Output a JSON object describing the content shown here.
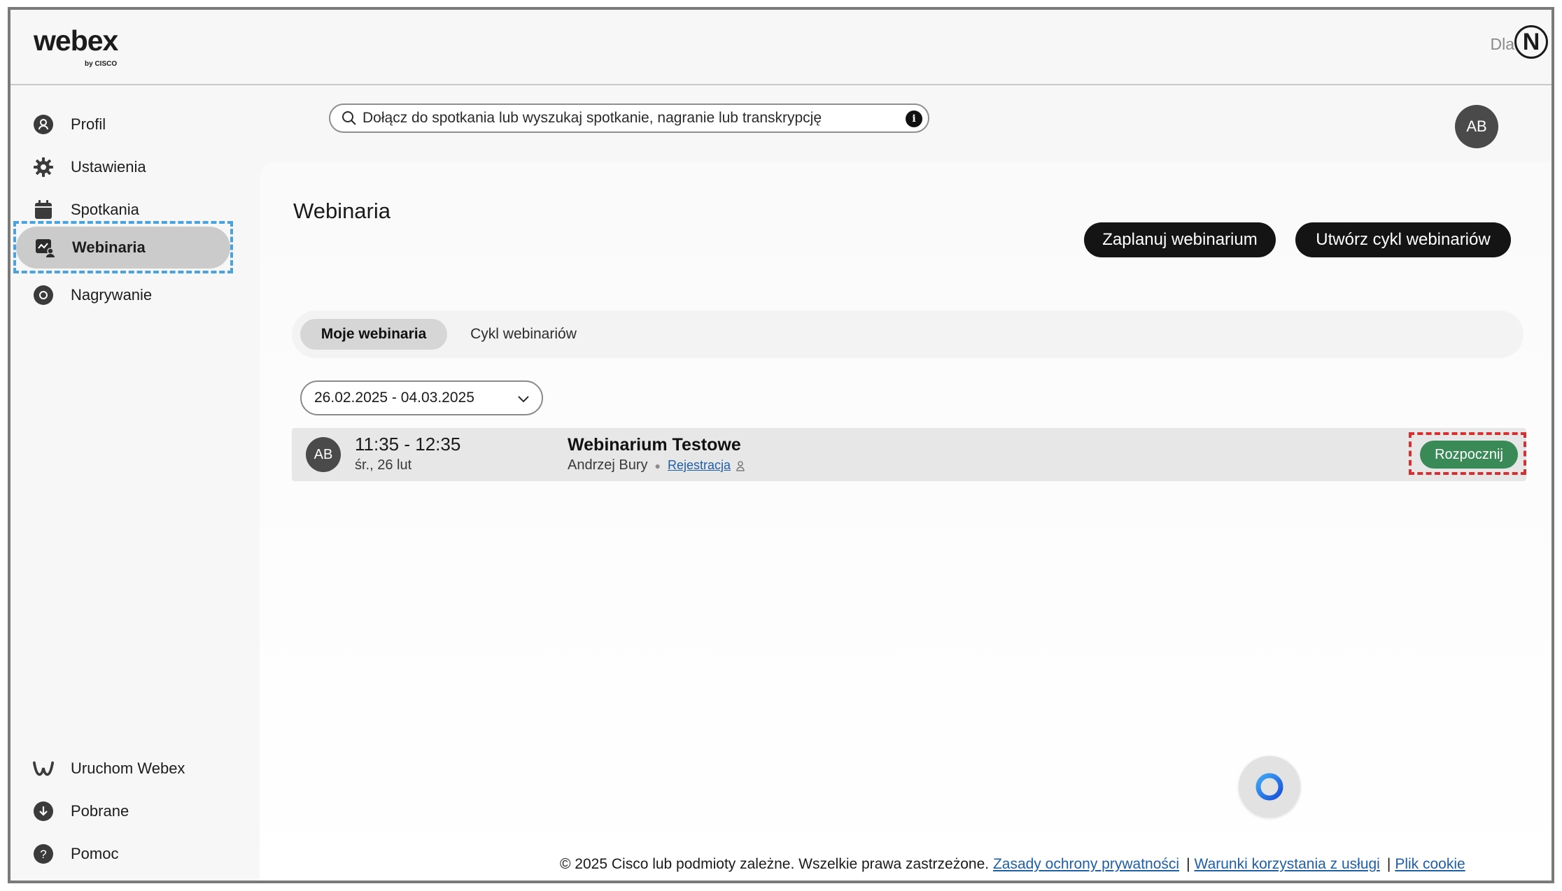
{
  "header": {
    "logo_text": "webex",
    "logo_sub": "by CISCO",
    "right_text": "Dla",
    "brand_letter": "N"
  },
  "sidebar": {
    "items": [
      {
        "label": "Profil",
        "icon": "profile-icon"
      },
      {
        "label": "Ustawienia",
        "icon": "gear-icon"
      },
      {
        "label": "Spotkania",
        "icon": "calendar-icon"
      },
      {
        "label": "Webinaria",
        "icon": "webinar-icon",
        "active": true
      },
      {
        "label": "Nagrywanie",
        "icon": "record-icon"
      }
    ],
    "bottom_items": [
      {
        "label": "Uruchom Webex",
        "icon": "webex-logo-icon"
      },
      {
        "label": "Pobrane",
        "icon": "download-icon"
      },
      {
        "label": "Pomoc",
        "icon": "help-icon"
      }
    ]
  },
  "search": {
    "placeholder": "Dołącz do spotkania lub wyszukaj spotkanie, nagranie lub transkrypcję"
  },
  "user": {
    "initials": "AB"
  },
  "main": {
    "title": "Webinaria",
    "schedule_button": "Zaplanuj webinarium",
    "create_series_button": "Utwórz cykl webinariów",
    "tabs": [
      {
        "label": "Moje webinaria",
        "selected": true
      },
      {
        "label": "Cykl webinariów",
        "selected": false
      }
    ],
    "date_range": "26.02.2025 - 04.03.2025",
    "webinars": [
      {
        "host_initials": "AB",
        "time": "11:35 - 12:35",
        "date": "śr., 26 lut",
        "title": "Webinarium Testowe",
        "host": "Andrzej Bury",
        "registration_link": "Rejestracja",
        "start_button": "Rozpocznij"
      }
    ]
  },
  "footer": {
    "copyright": "© 2025 Cisco lub podmioty zależne. Wszelkie prawa zastrzeżone.",
    "privacy": "Zasady ochrony prywatności",
    "terms": "Warunki korzystania z usługi",
    "cookies": "Plik cookie"
  },
  "colors": {
    "accent_start": "#3a8a58",
    "focus_blue": "#4aa3df",
    "focus_red": "#d83030",
    "link": "#1f5fa8"
  }
}
